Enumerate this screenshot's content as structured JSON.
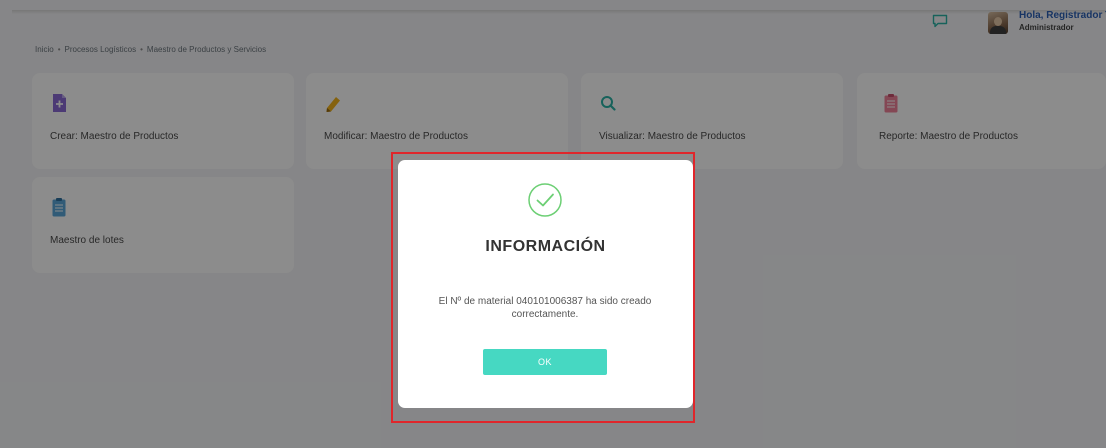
{
  "breadcrumb": [
    "Inicio",
    "Procesos Logísticos",
    "Maestro de Productos y Servicios"
  ],
  "breadcrumb_separator": "•",
  "header": {
    "greeting": "Hola, Registrador Te",
    "role": "Administrador",
    "chat_icon": "chat-bubble-icon",
    "accent_color": "#2b5fb5"
  },
  "cards": [
    {
      "label": "Crear: Maestro de Productos",
      "icon": "plus-document-icon",
      "icon_color": "#8a6ad6"
    },
    {
      "label": "Modificar: Maestro de Productos",
      "icon": "pencil-icon",
      "icon_color": "#f2b21b"
    },
    {
      "label": "Visualizar: Maestro de Productos",
      "icon": "search-icon",
      "icon_color": "#2bb3a6"
    },
    {
      "label": "Reporte: Maestro de Productos",
      "icon": "clipboard-icon",
      "icon_color": "#f0819a"
    },
    {
      "label": "Maestro de lotes",
      "icon": "clipboard-icon",
      "icon_color": "#5aa7d9"
    }
  ],
  "modal": {
    "title": "INFORMACIÓN",
    "message": "El Nº de material 040101006387 ha sido creado correctamente.",
    "ok_label": "OK",
    "status_icon": "check-circle-icon",
    "status_color": "#6ccf74",
    "button_color": "#46d8c2"
  }
}
